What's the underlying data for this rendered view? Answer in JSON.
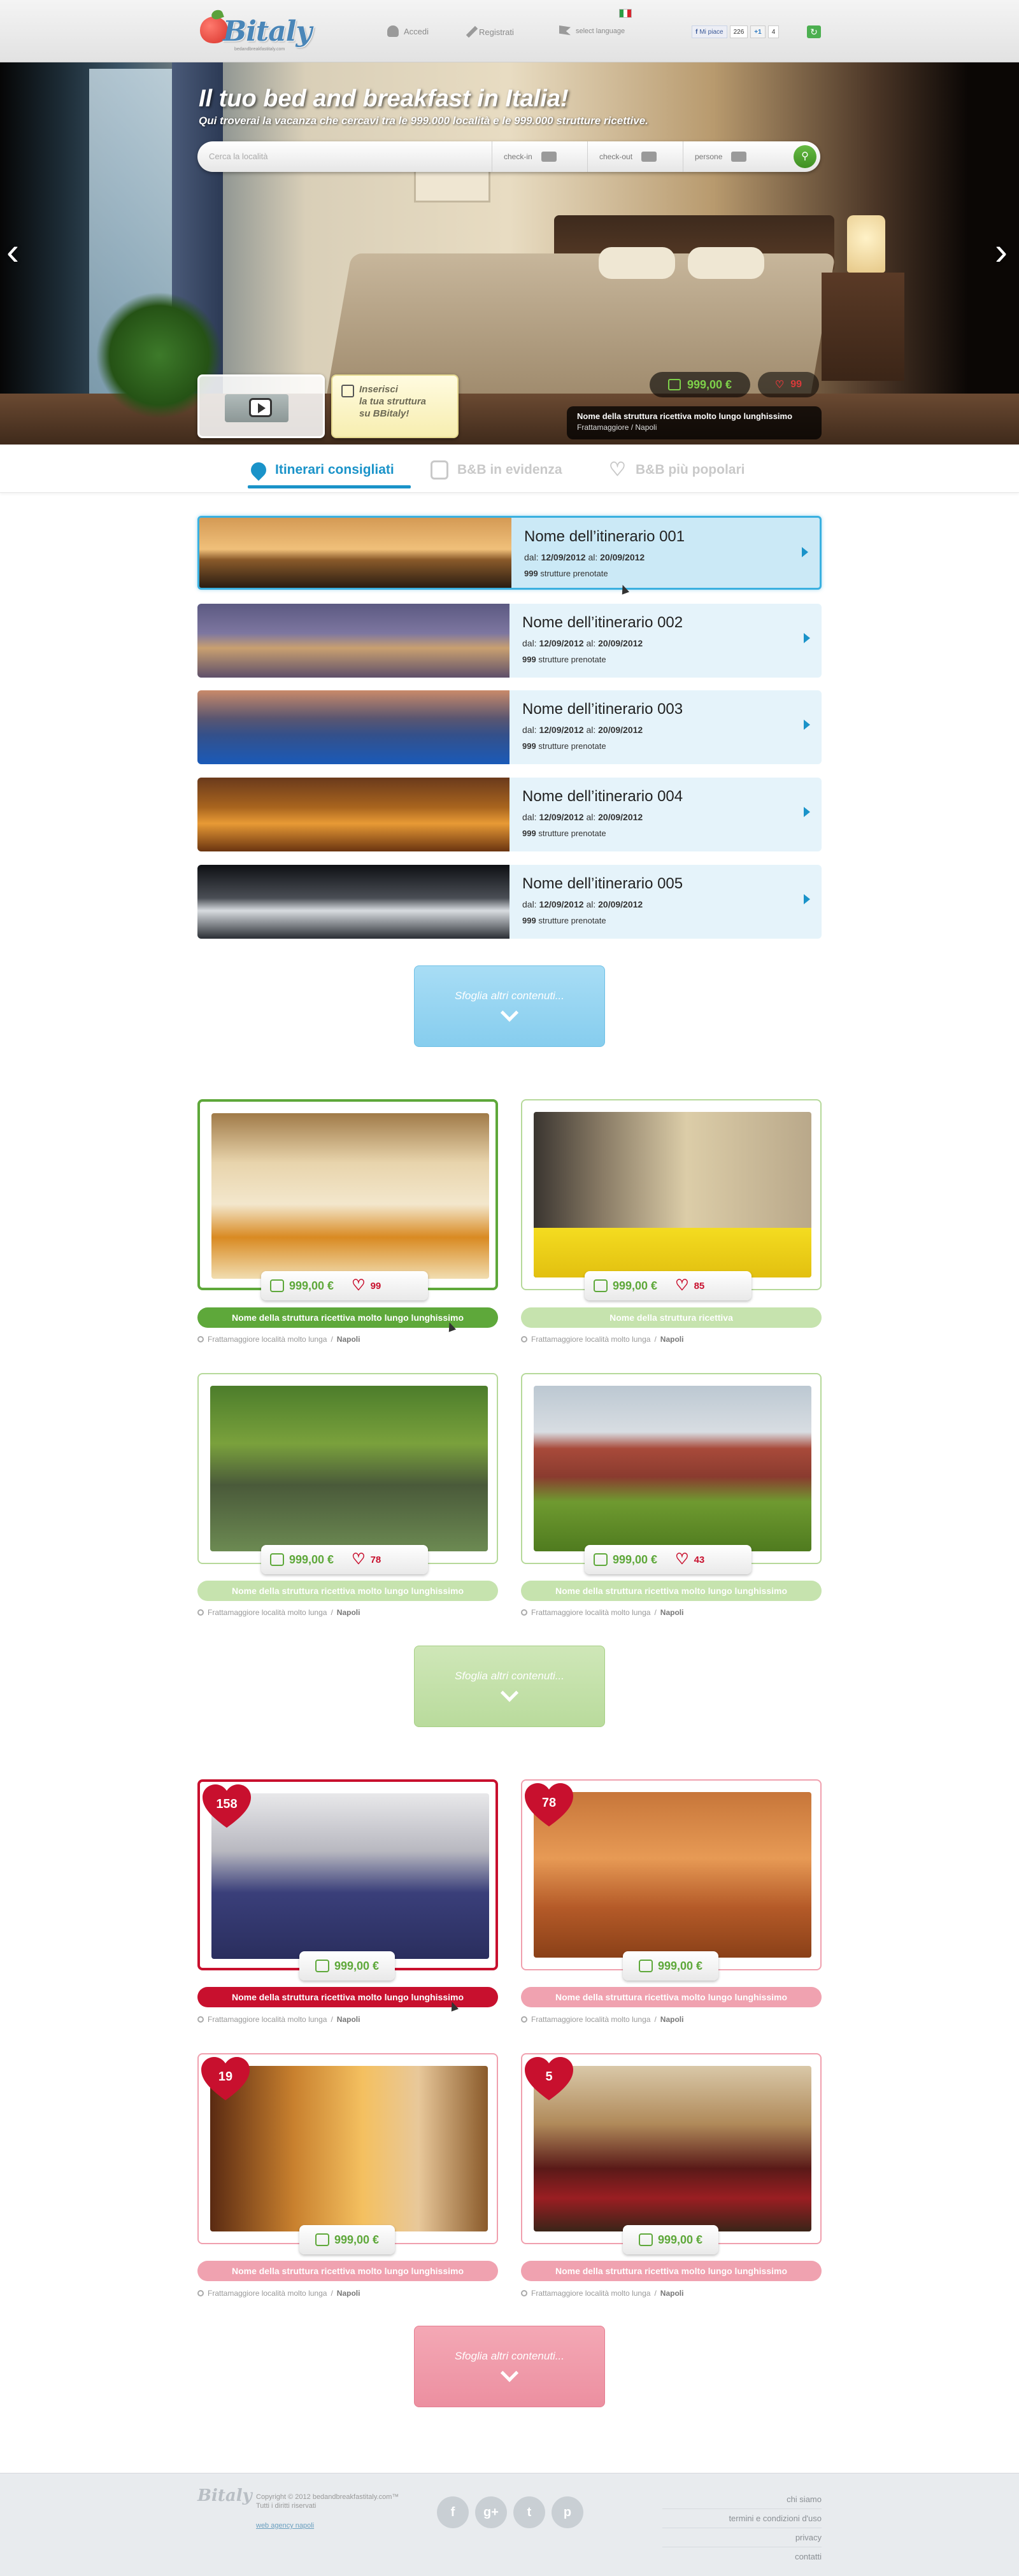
{
  "header": {
    "logo_text": "Bitaly",
    "tagline": "bedandbreakfastitaly.com",
    "login_label": "Accedi",
    "register_label": "Registrati",
    "language_label": "select language",
    "fb_like_label": "Mi piace",
    "fb_like_count": "226",
    "gplus_label": "+1",
    "gplus_count": "4",
    "share_icon": "share-icon"
  },
  "hero": {
    "title": "Il tuo bed and breakfast in Italia!",
    "subtitle": "Qui troverai la vacanza che cercavi tra le 999.000 località e le 999.000 strutture ricettive.",
    "search_placeholder": "Cerca la località",
    "checkin_label": "check-in",
    "checkout_label": "check-out",
    "persons_label": "persone",
    "insert_text": "Inserisci\nla tua struttura\nsu BBitaly!",
    "price": "999,00 €",
    "likes": "99",
    "caption_title": "Nome della struttura ricettiva molto lungo lunghissimo",
    "caption_location": "Frattamaggiore / Napoli"
  },
  "tabs": [
    {
      "label": "Itinerari consigliati",
      "active": true
    },
    {
      "label": "B&B in evidenza",
      "active": false
    },
    {
      "label": "B&B più popolari",
      "active": false
    }
  ],
  "itineraries": [
    {
      "title": "Nome dell’itinerario 001",
      "from_label": "dal:",
      "from": "12/09/2012",
      "to_label": "al:",
      "to": "20/09/2012",
      "count": "999",
      "count_label": "strutture prenotate"
    },
    {
      "title": "Nome dell’itinerario 002",
      "from_label": "dal:",
      "from": "12/09/2012",
      "to_label": "al:",
      "to": "20/09/2012",
      "count": "999",
      "count_label": "strutture prenotate"
    },
    {
      "title": "Nome dell’itinerario 003",
      "from_label": "dal:",
      "from": "12/09/2012",
      "to_label": "al:",
      "to": "20/09/2012",
      "count": "999",
      "count_label": "strutture prenotate"
    },
    {
      "title": "Nome dell’itinerario 004",
      "from_label": "dal:",
      "from": "12/09/2012",
      "to_label": "al:",
      "to": "20/09/2012",
      "count": "999",
      "count_label": "strutture prenotate"
    },
    {
      "title": "Nome dell’itinerario 005",
      "from_label": "dal:",
      "from": "12/09/2012",
      "to_label": "al:",
      "to": "20/09/2012",
      "count": "999",
      "count_label": "strutture prenotate"
    }
  ],
  "more_label": "Sfoglia altri contenuti...",
  "featured": [
    {
      "price": "999,00 €",
      "likes": "99",
      "name": "Nome della struttura ricettiva molto lungo lunghissimo",
      "location": "Frattamaggiore località molto lunga",
      "city": "Napoli"
    },
    {
      "price": "999,00 €",
      "likes": "85",
      "name": "Nome della struttura ricettiva",
      "location": "Frattamaggiore località molto lunga",
      "city": "Napoli"
    },
    {
      "price": "999,00 €",
      "likes": "78",
      "name": "Nome della struttura ricettiva molto lungo lunghissimo",
      "location": "Frattamaggiore località molto lunga",
      "city": "Napoli"
    },
    {
      "price": "999,00 €",
      "likes": "43",
      "name": "Nome della struttura ricettiva molto lungo lunghissimo",
      "location": "Frattamaggiore località molto lunga",
      "city": "Napoli"
    }
  ],
  "popular": [
    {
      "rank_likes": "158",
      "price": "999,00 €",
      "name": "Nome della struttura ricettiva molto lungo lunghissimo",
      "location": "Frattamaggiore località molto lunga",
      "city": "Napoli"
    },
    {
      "rank_likes": "78",
      "price": "999,00 €",
      "name": "Nome della struttura ricettiva molto lungo lunghissimo",
      "location": "Frattamaggiore località molto lunga",
      "city": "Napoli"
    },
    {
      "rank_likes": "19",
      "price": "999,00 €",
      "name": "Nome della struttura ricettiva molto lungo lunghissimo",
      "location": "Frattamaggiore località molto lunga",
      "city": "Napoli"
    },
    {
      "rank_likes": "5",
      "price": "999,00 €",
      "name": "Nome della struttura ricettiva molto lungo lunghissimo",
      "location": "Frattamaggiore località molto lunga",
      "city": "Napoli"
    }
  ],
  "footer": {
    "logo_text": "Bitaly",
    "copyright": "Copyright © 2012 bedandbreakfastitaly.com™\nTutti i diritti riservati",
    "agency_link": "web agency napoli",
    "social": [
      "f",
      "g+",
      "t",
      "p"
    ],
    "links": [
      "chi siamo",
      "termini e condizioni d'uso",
      "privacy",
      "contatti"
    ]
  },
  "colors": {
    "accent_blue": "#1a93c9",
    "accent_green": "#5ea83a",
    "accent_red": "#c8102e"
  }
}
